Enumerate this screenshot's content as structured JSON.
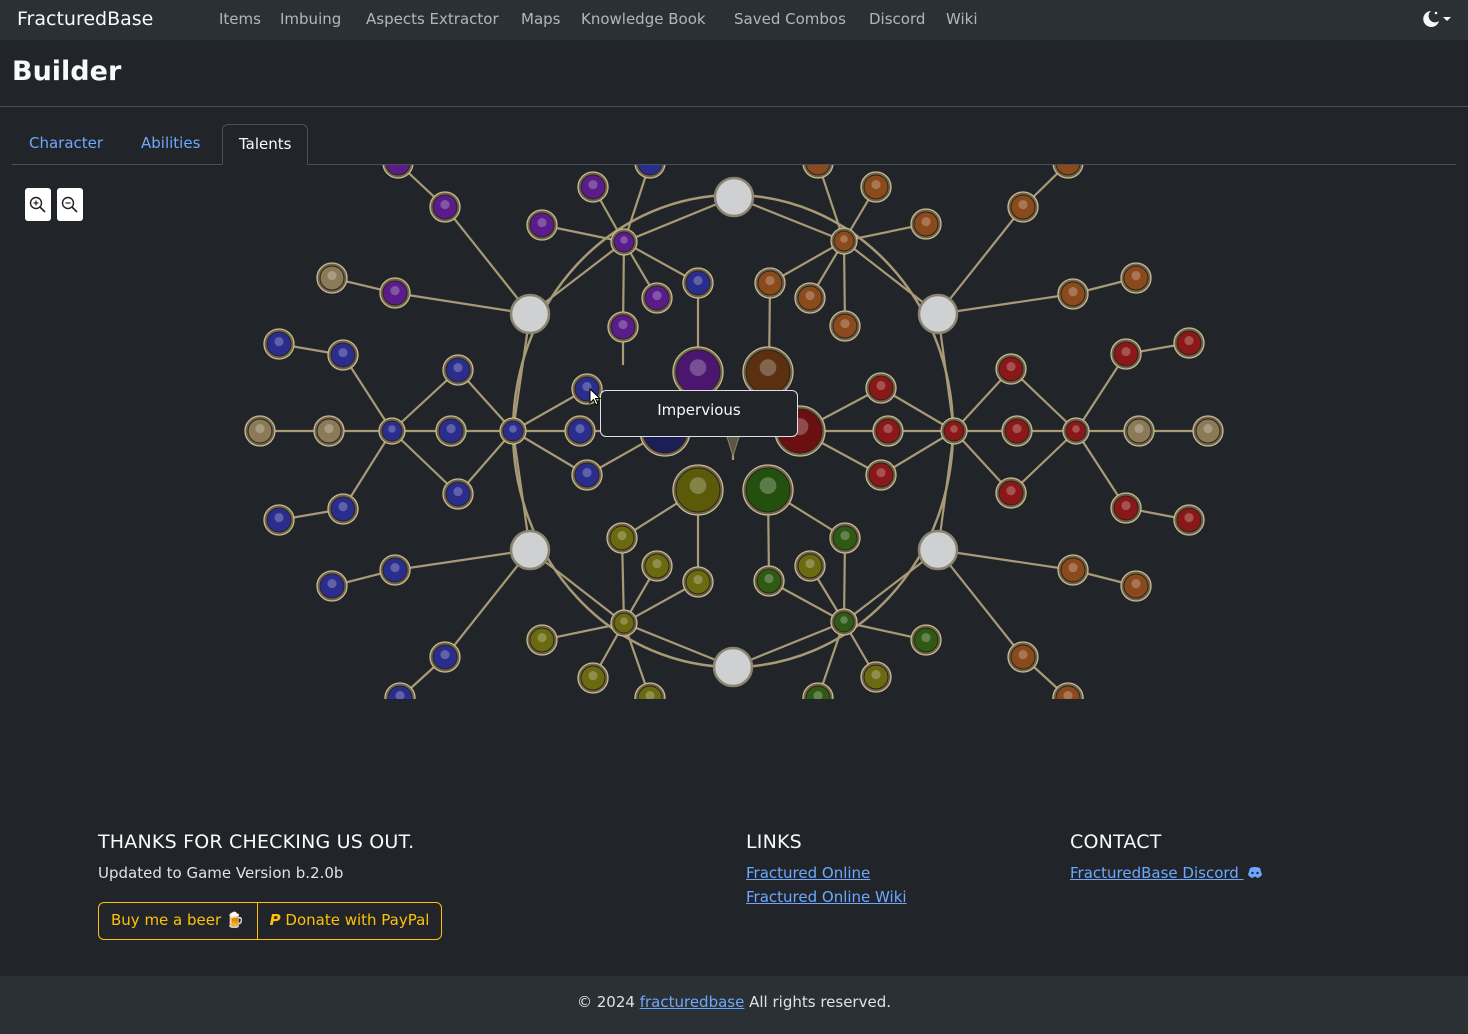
{
  "navbar": {
    "brand": "FracturedBase",
    "items": [
      "Items",
      "Imbuing",
      "Aspects Extractor",
      "Maps",
      "Knowledge Book",
      "Saved Combos",
      "Discord",
      "Wiki"
    ],
    "theme_icon": "moon-icon"
  },
  "page": {
    "title": "Builder"
  },
  "tabs": [
    {
      "label": "Character",
      "active": false
    },
    {
      "label": "Abilities",
      "active": false
    },
    {
      "label": "Talents",
      "active": true
    }
  ],
  "zoom": {
    "in_icon": "zoom-in-icon",
    "out_icon": "zoom-out-icon"
  },
  "tree": {
    "tooltip": "Impervious",
    "colors": {
      "line": "#a89a76",
      "purple": "#5a1c8a",
      "blue": "#2a2d8c",
      "orange": "#8a4a1c",
      "red": "#8a1818",
      "yellow": "#6a6a10",
      "green": "#2e5a14",
      "empty": "#cfd0d2",
      "tan": "#8a7a58"
    }
  },
  "footer": {
    "thanks_heading": "THANKS FOR CHECKING US OUT.",
    "version_text": "Updated to Game Version b.2.0b",
    "beer_button": "Buy me a beer 🍺",
    "paypal_button": "Donate with PayPal",
    "links_heading": "LINKS",
    "links": [
      "Fractured Online",
      "Fractured Online Wiki"
    ],
    "contact_heading": "CONTACT",
    "discord_link": "FracturedBase Discord",
    "copyright_prefix": "© 2024",
    "copyright_link": "fracturedbase",
    "copyright_suffix": "All rights reserved."
  }
}
